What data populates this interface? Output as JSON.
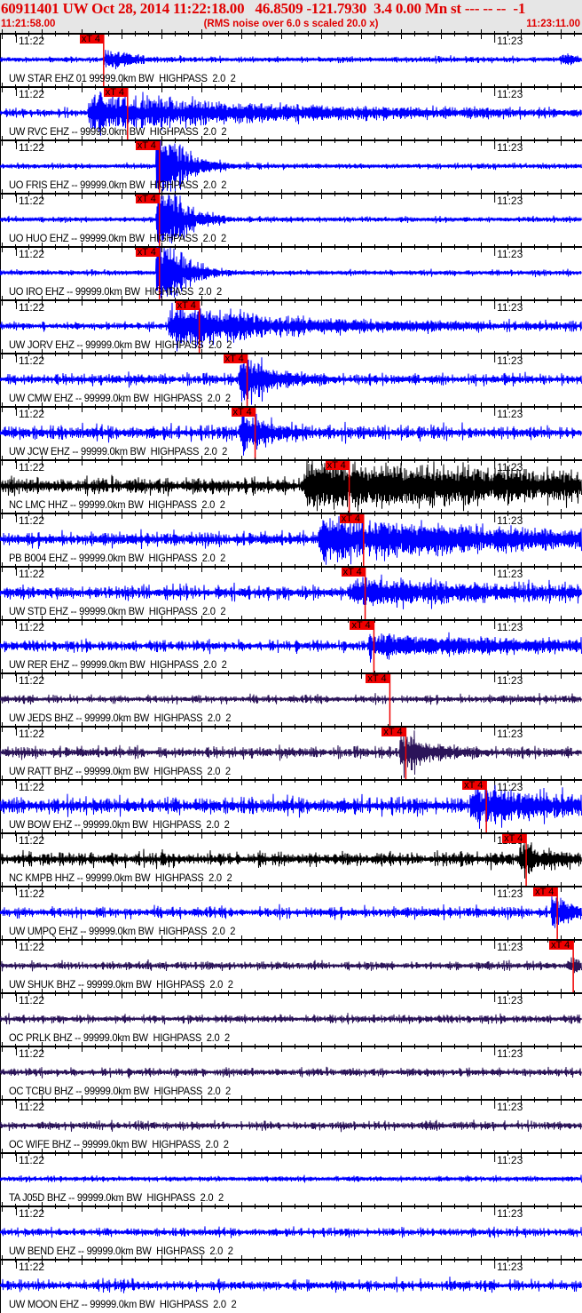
{
  "header": {
    "title": "60911401 UW Oct 28, 2014 11:22:18.00   46.8509 -121.7930  3.4 0.00 Mn st --- -- --  -1",
    "start_time": "11:21:58.00",
    "end_time": "11:23:11.00",
    "rms_note": "(RMS noise over 6.0 s scaled 20.0 x)"
  },
  "chart_data": {
    "type": "line",
    "title": "60911401 UW Oct 28, 2014 11:22:18.00",
    "x_range_seconds": [
      0,
      73
    ],
    "x_start": "11:21:58.00",
    "time_ticks": [
      {
        "label": "11:22",
        "t": 2
      },
      {
        "label": "11:23",
        "t": 62
      }
    ],
    "pick_label": "xT 4",
    "colors": {
      "blue": "#0000ff",
      "black": "#000000",
      "purple": "#2b1459",
      "pick": "#f00000"
    },
    "traces": [
      {
        "label": "UW STAR EHZ 01 99999.0km BW  HIGHPASS  2.0  2",
        "color": "blue",
        "pick": 13.0,
        "noise": 2,
        "ev": [
          13,
          14,
          3
        ],
        "ev2": [
          70,
          8,
          3
        ]
      },
      {
        "label": "UW RVC EHZ -- 99999.0km BW  HIGHPASS  2.0  2",
        "color": "blue",
        "pick": 16.0,
        "noise": 3,
        "ev": [
          11,
          22,
          22
        ]
      },
      {
        "label": "UO FRIS EHZ -- 99999.0km BW  HIGHPASS  2.0  2",
        "color": "blue",
        "pick": 20.0,
        "noise": 2,
        "ev": [
          19.5,
          80,
          2.5
        ]
      },
      {
        "label": "UO HUO EHZ -- 99999.0km BW  HIGHPASS  2.0  2",
        "color": "blue",
        "pick": 20.0,
        "noise": 2,
        "ev": [
          19.5,
          80,
          2.5
        ]
      },
      {
        "label": "UO IRO EHZ -- 99999.0km BW  HIGHPASS  2.0  2",
        "color": "blue",
        "pick": 20.0,
        "noise": 2,
        "ev": [
          19.5,
          80,
          2.5
        ]
      },
      {
        "label": "UW JORV EHZ -- 99999.0km BW  HIGHPASS  2.0  2",
        "color": "blue",
        "pick": 25.0,
        "noise": 3,
        "ev": [
          21,
          26,
          14
        ]
      },
      {
        "label": "UW CMW EHZ -- 99999.0km BW  HIGHPASS  2.0  2",
        "color": "blue",
        "pick": 31.0,
        "noise": 4,
        "ev": [
          30,
          40,
          3
        ]
      },
      {
        "label": "UW JCW EHZ -- 99999.0km BW  HIGHPASS  2.0  2",
        "color": "blue",
        "pick": 32.0,
        "noise": 5,
        "ev": [
          30,
          26,
          3
        ]
      },
      {
        "label": "NC LMC HHZ -- 99999.0km BW  HIGHPASS  2.0  2",
        "color": "black",
        "pick": 43.8,
        "noise": 6,
        "ev": [
          38,
          26,
          45
        ]
      },
      {
        "label": "PB B004 EHZ -- 99999.0km BW  HIGHPASS  2.0  2",
        "color": "blue",
        "pick": 45.6,
        "noise": 5,
        "ev": [
          40,
          26,
          22
        ]
      },
      {
        "label": "UW STD EHZ -- 99999.0km BW  HIGHPASS  2.0  2",
        "color": "blue",
        "pick": 45.8,
        "noise": 5,
        "ev": [
          44,
          14,
          18
        ]
      },
      {
        "label": "UW RER EHZ -- 99999.0km BW  HIGHPASS  2.0  2",
        "color": "blue",
        "pick": 46.9,
        "noise": 4,
        "ev": [
          46,
          12,
          20
        ]
      },
      {
        "label": "UW JEDS BHZ -- 99999.0km BW  HIGHPASS  2.0  2",
        "color": "purple",
        "pick": 48.9,
        "noise": 3
      },
      {
        "label": "UW RATT BHZ -- 99999.0km BW  HIGHPASS  2.0  2",
        "color": "purple",
        "pick": 50.9,
        "noise": 4,
        "ev": [
          50,
          30,
          3
        ]
      },
      {
        "label": "UW BOW EHZ -- 99999.0km BW  HIGHPASS  2.0  2",
        "color": "blue",
        "pick": 61.0,
        "noise": 6,
        "ev": [
          59,
          20,
          10
        ]
      },
      {
        "label": "NC KMPB HHZ -- 99999.0km BW  HIGHPASS  2.0  2",
        "color": "black",
        "pick": 66.0,
        "noise": 5,
        "ev": [
          65,
          16,
          4
        ]
      },
      {
        "label": "UW UMPQ EHZ -- 99999.0km BW  HIGHPASS  2.0  2",
        "color": "blue",
        "pick": 69.9,
        "noise": 4,
        "ev": [
          69,
          24,
          2
        ]
      },
      {
        "label": "UW SHUK BHZ -- 99999.0km BW  HIGHPASS  2.0  2",
        "color": "purple",
        "pick": 71.9,
        "noise": 3,
        "ev": [
          71,
          10,
          2
        ]
      },
      {
        "label": "OC PRLK BHZ -- 99999.0km BW  HIGHPASS  2.0  2",
        "color": "purple",
        "noise": 3
      },
      {
        "label": "OC TCBU BHZ -- 99999.0km BW  HIGHPASS  2.0  2",
        "color": "purple",
        "noise": 3
      },
      {
        "label": "OC WIFE BHZ -- 99999.0km BW  HIGHPASS  2.0  2",
        "color": "purple",
        "noise": 3
      },
      {
        "label": "TA J05D BHZ -- 99999.0km BW  HIGHPASS  2.0  2",
        "color": "blue",
        "noise": 2
      },
      {
        "label": "UW BEND EHZ -- 99999.0km BW  HIGHPASS  2.0  2",
        "color": "blue",
        "noise": 3
      },
      {
        "label": "UW MOON EHZ -- 99999.0km BW  HIGHPASS  2.0  2",
        "color": "blue",
        "noise": 4
      }
    ]
  }
}
